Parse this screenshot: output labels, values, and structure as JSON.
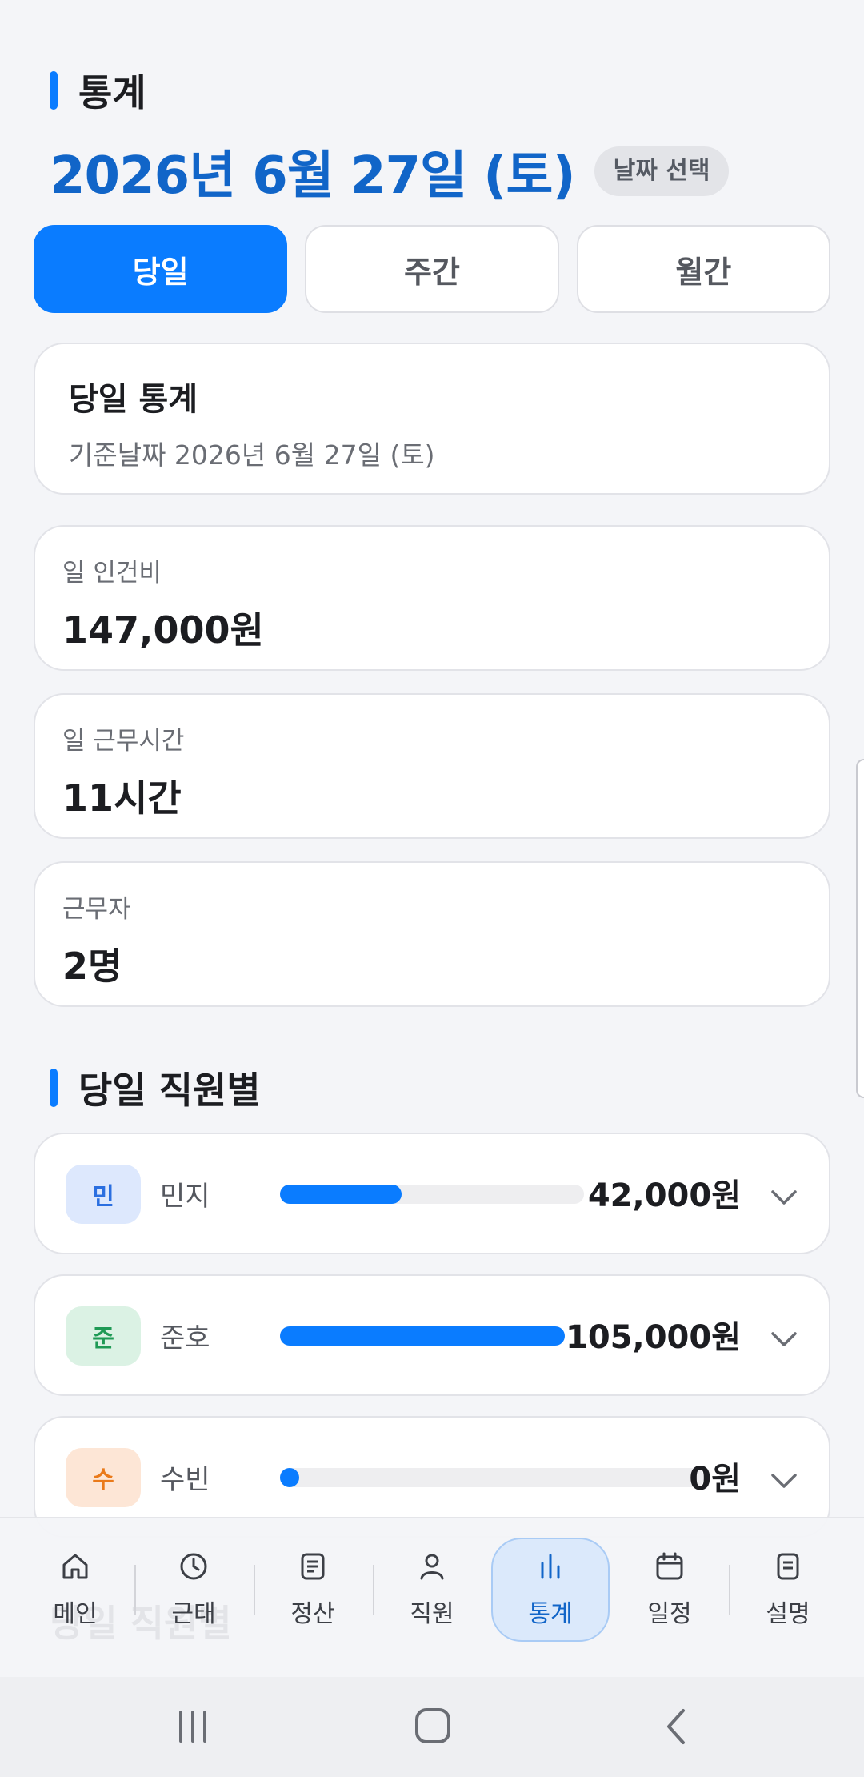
{
  "header": {
    "section_title": "통계",
    "date": "2026년 6월 27일 (토)",
    "date_picker_label": "날짜 선택"
  },
  "tabs": [
    {
      "label": "당일",
      "active": true
    },
    {
      "label": "주간",
      "active": false
    },
    {
      "label": "월간",
      "active": false
    }
  ],
  "summary": {
    "title": "당일 통계",
    "subtitle": "기준날짜 2026년 6월 27일 (토)"
  },
  "stats": [
    {
      "label": "일 인건비",
      "value": "147,000원"
    },
    {
      "label": "일 근무시간",
      "value": "11시간"
    },
    {
      "label": "근무자",
      "value": "2명"
    }
  ],
  "employees_section": {
    "title": "당일 직원별",
    "items": [
      {
        "initial": "민",
        "name": "민지",
        "amount": "42,000원",
        "ratio": 0.4,
        "badge_bg": "#dde8fd",
        "badge_fg": "#2b6fe0"
      },
      {
        "initial": "준",
        "name": "준호",
        "amount": "105,000원",
        "ratio": 1.0,
        "badge_bg": "#dbf2e4",
        "badge_fg": "#1f9a55"
      },
      {
        "initial": "수",
        "name": "수빈",
        "amount": "0원",
        "ratio": 0.0,
        "badge_bg": "#fde6d6",
        "badge_fg": "#ea7a1a"
      }
    ]
  },
  "bottom_nav": {
    "ghost_text": "당일 직원별",
    "items": [
      {
        "label": "메인",
        "icon": "home-icon"
      },
      {
        "label": "근태",
        "icon": "clock-icon"
      },
      {
        "label": "정산",
        "icon": "document-icon"
      },
      {
        "label": "직원",
        "icon": "person-icon"
      },
      {
        "label": "통계",
        "icon": "bar-chart-icon",
        "active": true
      },
      {
        "label": "일정",
        "icon": "calendar-icon"
      },
      {
        "label": "설명",
        "icon": "notes-icon"
      }
    ]
  },
  "colors": {
    "accent": "#0a7cff",
    "date_text": "#1165c8",
    "background": "#f4f5f8"
  }
}
